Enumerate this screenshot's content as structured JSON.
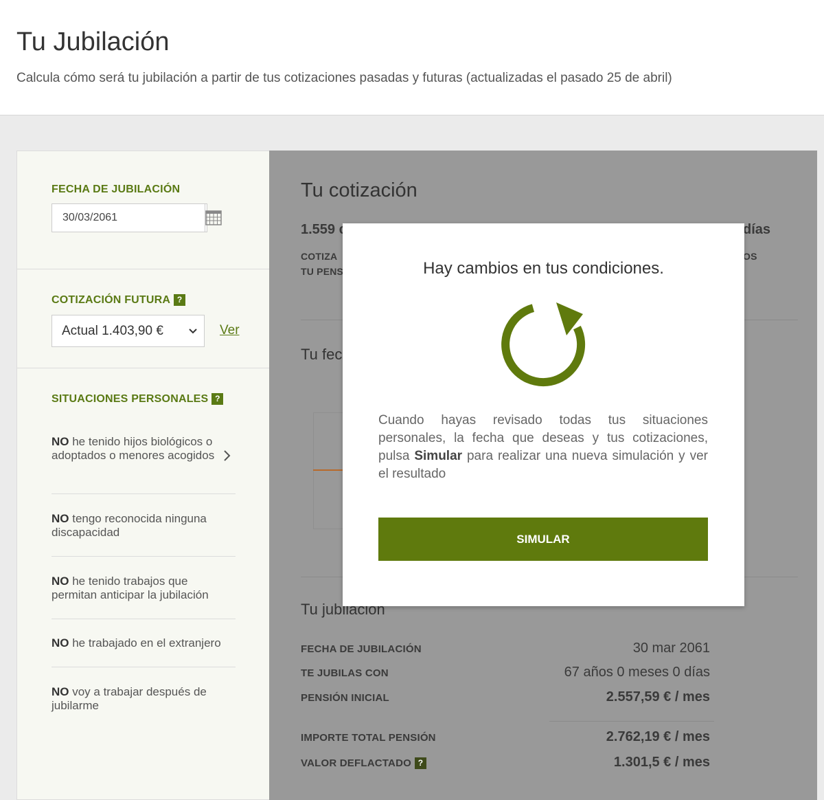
{
  "header": {
    "title": "Tu Jubilación",
    "subtitle": "Calcula cómo será tu jubilación a partir de tus cotizaciones pasadas y futuras (actualizadas el pasado 25 de abril)"
  },
  "sidebar": {
    "fecha": {
      "label": "FECHA DE JUBILACIÓN",
      "value": "30/03/2061"
    },
    "cotizacion": {
      "label": "COTIZACIÓN FUTURA",
      "help": "?",
      "selected": "Actual 1.403,90 €",
      "link": "Ver"
    },
    "situaciones": {
      "label": "SITUACIONES PERSONALES",
      "help": "?",
      "items": [
        {
          "strong": "NO",
          "text": " he tenido hijos biológicos o adoptados o menores acogidos"
        },
        {
          "strong": "NO",
          "text": " tengo reconocida ninguna discapacidad"
        },
        {
          "strong": "NO",
          "text": " he tenido trabajos que permitan anticipar la jubilación"
        },
        {
          "strong": "NO",
          "text": " he trabajado en el extranjero"
        },
        {
          "strong": "NO",
          "text": " voy a trabajar después de jubilarme"
        }
      ]
    }
  },
  "main": {
    "cotizacion_title": "Tu cotización",
    "cotizacion_value_partial": "1.559 c",
    "cotizacion_value_right": "días",
    "cotizacion_label_1": "COTIZA",
    "cotizacion_label_2": "TU PENS",
    "cotizacion_label_right": "OS",
    "fecha_title_partial": "Tu fec",
    "jubilacion_title": "Tu jubilación",
    "rows": [
      {
        "label": "FECHA DE JUBILACIÓN",
        "value": "30 mar 2061"
      },
      {
        "label": "TE JUBILAS CON",
        "value": "67 años 0 meses 0 días"
      },
      {
        "label": "PENSIÓN INICIAL",
        "value": "2.557,59 € / mes"
      },
      {
        "label": "IMPORTE TOTAL PENSIÓN",
        "value": "2.762,19 € / mes"
      },
      {
        "label": "VALOR DEFLACTADO",
        "value": "1.301,5 € / mes",
        "help": "?"
      }
    ]
  },
  "modal": {
    "title": "Hay cambios en tus condiciones.",
    "text_before": "Cuando hayas revisado todas tus situaciones personales, la fecha que deseas y tus cotizaciones, pulsa ",
    "text_bold": "Simular",
    "text_after": " para realizar una nueva simulación y ver el resultado",
    "button": "SIMULAR",
    "icon": "refresh-icon"
  },
  "colors": {
    "accent": "#5f7a0d",
    "overlay": "#999999"
  }
}
